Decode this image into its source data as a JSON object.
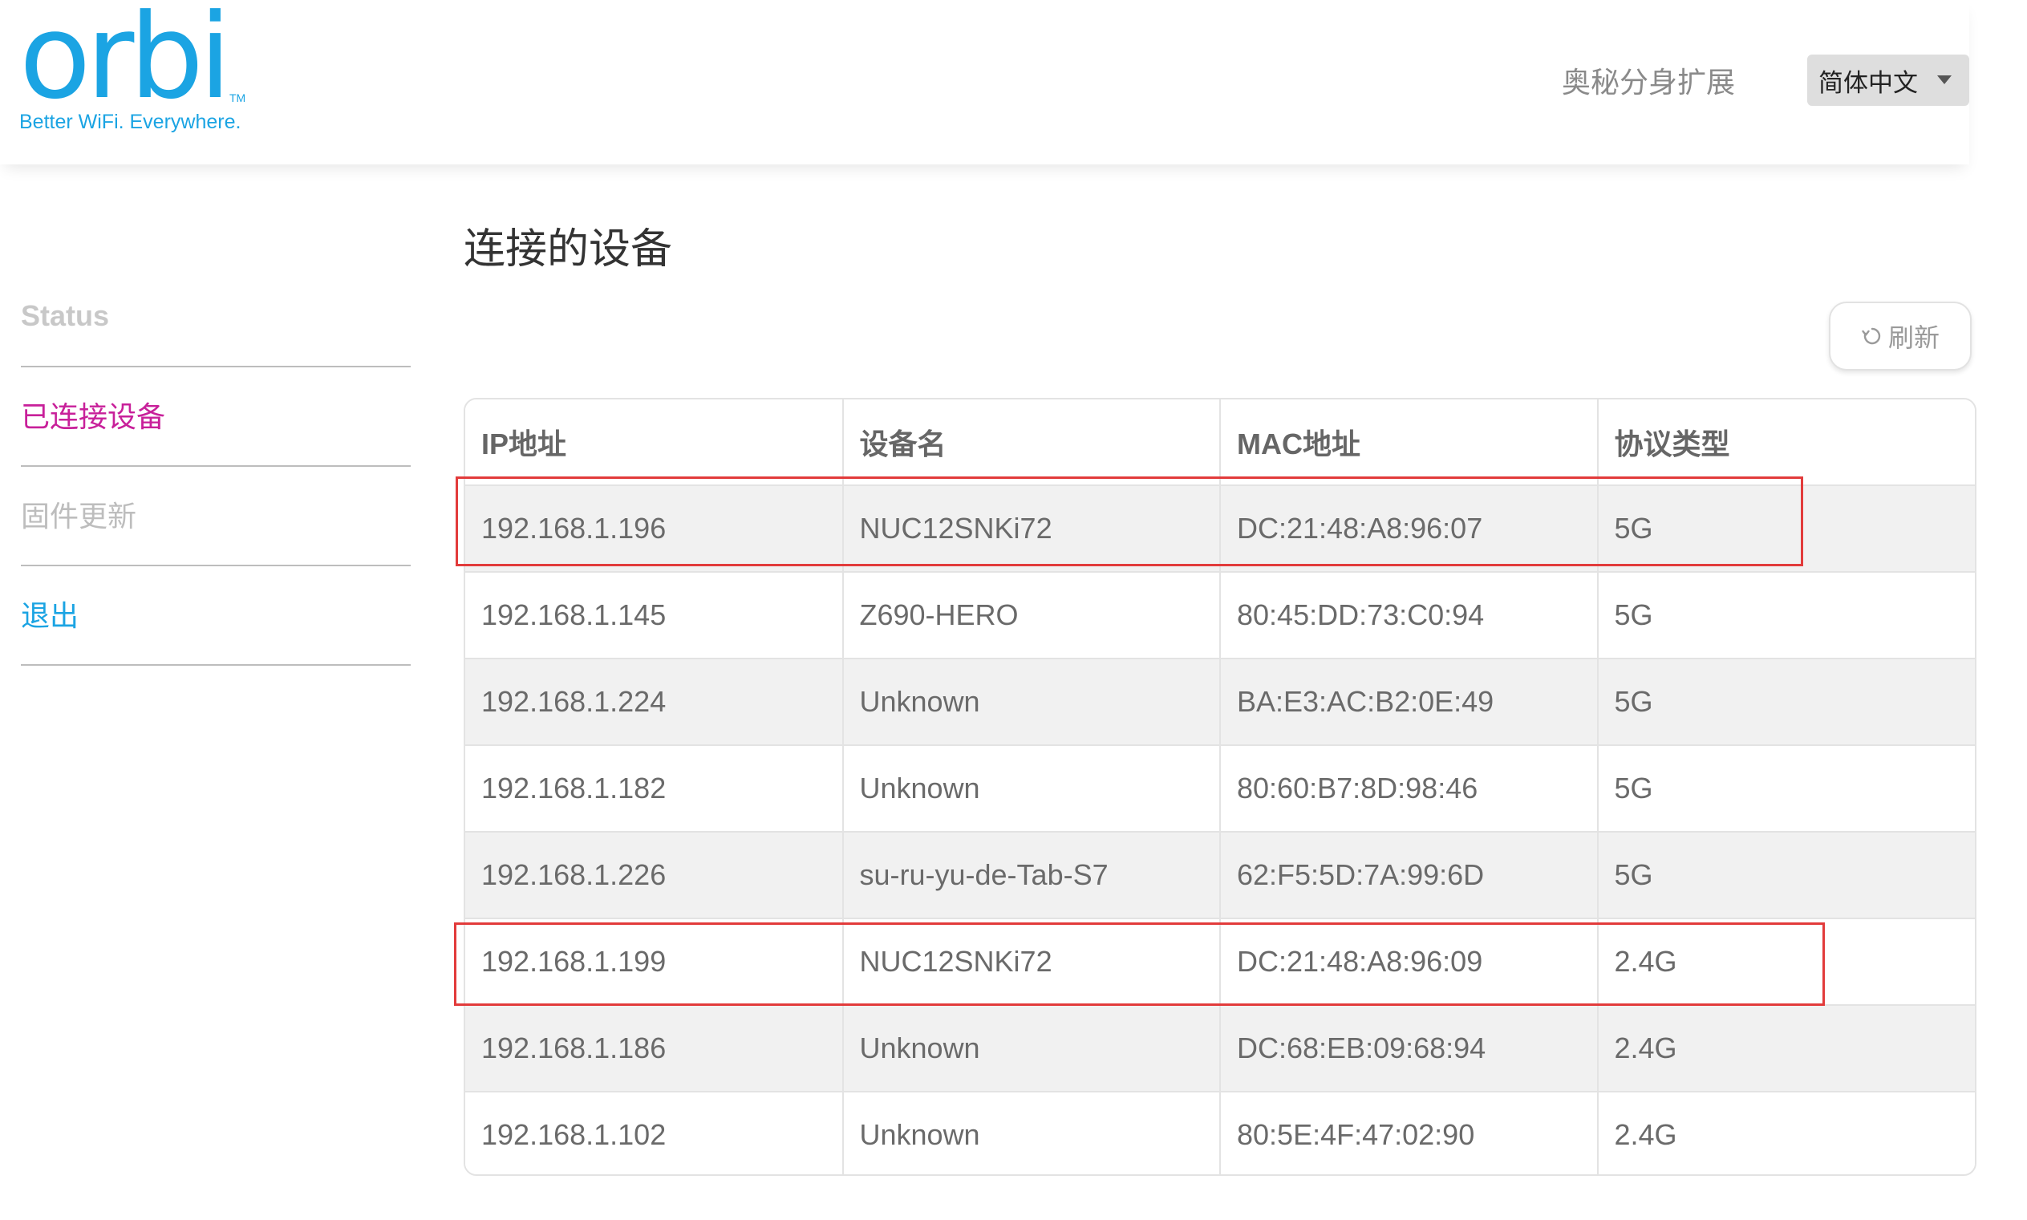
{
  "brand": {
    "logo_text": "orbi",
    "trademark": "TM",
    "tagline": "Better WiFi. Everywhere."
  },
  "header": {
    "extender_title": "奥秘分身扩展",
    "language": {
      "selected": "简体中文"
    }
  },
  "sidebar": {
    "items": [
      {
        "label": "Status"
      },
      {
        "label": "已连接设备"
      },
      {
        "label": "固件更新"
      },
      {
        "label": "退出"
      }
    ]
  },
  "main": {
    "title": "连接的设备",
    "refresh_label": "刷新",
    "table": {
      "columns": [
        "IP地址",
        "设备名",
        "MAC地址",
        "协议类型"
      ],
      "rows": [
        {
          "ip": "192.168.1.196",
          "name": "NUC12SNKi72",
          "mac": "DC:21:48:A8:96:07",
          "protocol": "5G"
        },
        {
          "ip": "192.168.1.145",
          "name": "Z690-HERO",
          "mac": "80:45:DD:73:C0:94",
          "protocol": "5G"
        },
        {
          "ip": "192.168.1.224",
          "name": "Unknown",
          "mac": "BA:E3:AC:B2:0E:49",
          "protocol": "5G"
        },
        {
          "ip": "192.168.1.182",
          "name": "Unknown",
          "mac": "80:60:B7:8D:98:46",
          "protocol": "5G"
        },
        {
          "ip": "192.168.1.226",
          "name": "su-ru-yu-de-Tab-S7",
          "mac": "62:F5:5D:7A:99:6D",
          "protocol": "5G"
        },
        {
          "ip": "192.168.1.199",
          "name": "NUC12SNKi72",
          "mac": "DC:21:48:A8:96:09",
          "protocol": "2.4G"
        },
        {
          "ip": "192.168.1.186",
          "name": "Unknown",
          "mac": "DC:68:EB:09:68:94",
          "protocol": "2.4G"
        },
        {
          "ip": "192.168.1.102",
          "name": "Unknown",
          "mac": "80:5E:4F:47:02:90",
          "protocol": "2.4G"
        }
      ]
    }
  },
  "colors": {
    "brand_blue": "#1ba4e3",
    "active_nav": "#c8209a",
    "highlight_red": "#e23b3b"
  }
}
